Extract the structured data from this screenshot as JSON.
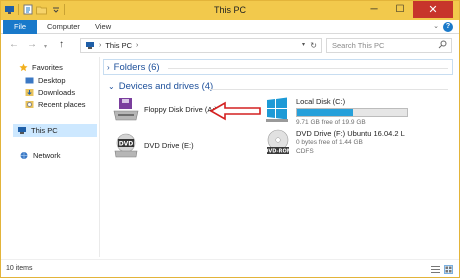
{
  "window": {
    "title": "This PC",
    "minimize": "─",
    "maximize": "☐",
    "close": "✕"
  },
  "ribbon": {
    "tabs": [
      "File",
      "Computer",
      "View"
    ],
    "help": "?",
    "expand": "⌄"
  },
  "address": {
    "path": "This PC",
    "search_placeholder": "Search This PC"
  },
  "nav_pane": {
    "favorites_label": "Favorites",
    "favorites": [
      "Desktop",
      "Downloads",
      "Recent places"
    ],
    "this_pc": "This PC",
    "network": "Network"
  },
  "content": {
    "folders_group": "Folders (6)",
    "devices_group": "Devices and drives (4)",
    "drives": [
      {
        "name": "Floppy Disk Drive (A:)"
      },
      {
        "name": "Local Disk (C:)",
        "free_text": "9.71 GB free of 19.9 GB",
        "used_fraction": 0.512
      },
      {
        "name": "DVD Drive (E:)"
      },
      {
        "name": "DVD Drive (F:) Ubuntu 16.04.2 L",
        "free_text": "0 bytes free of 1.44 GB",
        "filesystem": "CDFS"
      }
    ]
  },
  "status_bar": {
    "item_count": "10 items"
  },
  "colors": {
    "accent": "#1979ca",
    "titlebar": "#f2c94c",
    "drive_bar": "#26a0da",
    "arrow": "#d42020"
  }
}
